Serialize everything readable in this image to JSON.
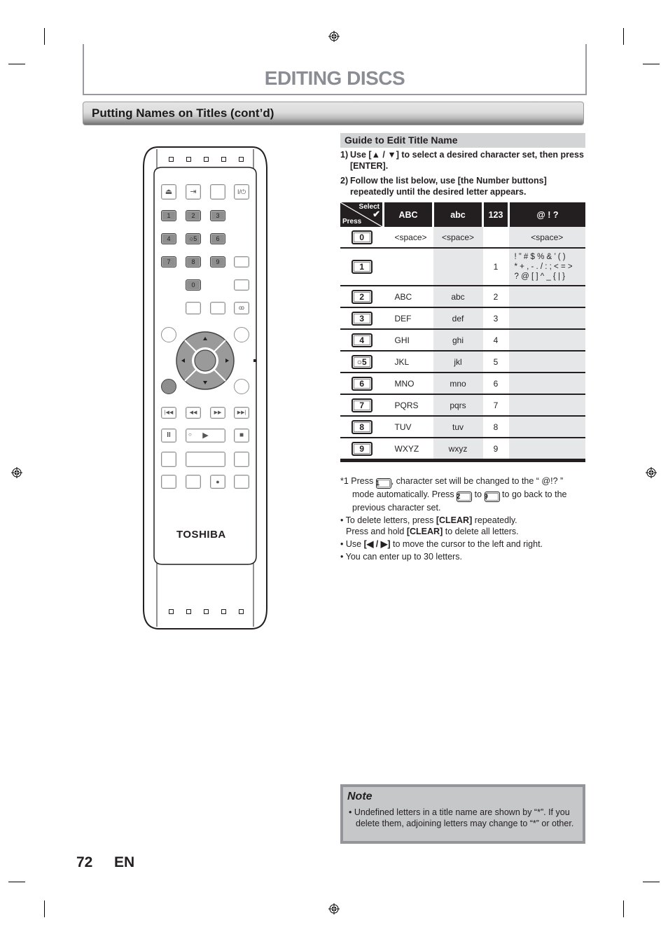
{
  "header": {
    "chapter_title": "EDITING DISCS",
    "section_title": "Putting Names on Titles (cont’d)"
  },
  "guide": {
    "heading": "Guide to Edit Title Name",
    "steps": [
      {
        "num": "1)",
        "text": "Use [▲ / ▼] to select a desired character set, then press [ENTER]."
      },
      {
        "num": "2)",
        "text": "Follow the list below, use [the Number buttons] repeatedly until the desired letter appears."
      }
    ]
  },
  "char_table": {
    "corner_top": "Select",
    "corner_bottom": "Press",
    "columns": [
      "ABC",
      "abc",
      "123",
      "@ ! ?"
    ],
    "rows": [
      {
        "key": "0",
        "abc_upper": "<space>",
        "abc_lower": "<space>",
        "num": "",
        "symbols": "<space>"
      },
      {
        "key": "1",
        "abc_upper": "",
        "abc_lower": "",
        "num": "1",
        "symbols": "! ” # $ % & ’ ( )\n* + , - . / : ; < = >\n? @ [ ] ^ _ { | }"
      },
      {
        "key": "2",
        "abc_upper": "ABC",
        "abc_lower": "abc",
        "num": "2",
        "symbols": ""
      },
      {
        "key": "3",
        "abc_upper": "DEF",
        "abc_lower": "def",
        "num": "3",
        "symbols": ""
      },
      {
        "key": "4",
        "abc_upper": "GHI",
        "abc_lower": "ghi",
        "num": "4",
        "symbols": ""
      },
      {
        "key": "○5",
        "abc_upper": "JKL",
        "abc_lower": "jkl",
        "num": "5",
        "symbols": ""
      },
      {
        "key": "6",
        "abc_upper": "MNO",
        "abc_lower": "mno",
        "num": "6",
        "symbols": ""
      },
      {
        "key": "7",
        "abc_upper": "PQRS",
        "abc_lower": "pqrs",
        "num": "7",
        "symbols": ""
      },
      {
        "key": "8",
        "abc_upper": "TUV",
        "abc_lower": "tuv",
        "num": "8",
        "symbols": ""
      },
      {
        "key": "9",
        "abc_upper": "WXYZ",
        "abc_lower": "wxyz",
        "num": "9",
        "symbols": ""
      }
    ]
  },
  "notes": {
    "footnote_prefix": "*1 Press",
    "footnote_key1": "1",
    "footnote_mid1": ", character set will be changed to the “ @!? ” mode automatically. Press",
    "footnote_key2": "2",
    "footnote_to": "to",
    "footnote_key3": "9",
    "footnote_end": "to go back to the previous character set.",
    "bullet1_a": "• To delete letters, press ",
    "bullet1_b": "[CLEAR]",
    "bullet1_c": " repeatedly.",
    "bullet1_d": "Press and hold ",
    "bullet1_e": "[CLEAR]",
    "bullet1_f": " to delete all letters.",
    "bullet2_a": "• Use ",
    "bullet2_b": "[◀ / ▶]",
    "bullet2_c": " to move the cursor to the left and right.",
    "bullet3": "• You can enter up to 30 letters."
  },
  "note_box": {
    "title": "Note",
    "text": "• Undefined letters in a title name are shown by “*”. If you delete them, adjoining letters may change to “*” or other."
  },
  "footer": {
    "page_number": "72",
    "language": "EN"
  },
  "remote": {
    "brand": "TOSHIBA",
    "number_keys": [
      "1",
      "2",
      "3",
      "4",
      "○5",
      "6",
      "7",
      "8",
      "9",
      "0"
    ],
    "power_label": "I/⏻",
    "icons": {
      "eject": "eject-icon",
      "input": "input-icon",
      "power": "power-icon",
      "audio": "audio-icon",
      "skip_back": "skip-back-icon",
      "rewind": "rewind-icon",
      "fast_forward": "fast-forward-icon",
      "skip_forward": "skip-forward-icon",
      "pause": "pause-icon",
      "play": "play-icon",
      "stop": "stop-icon",
      "record": "record-icon"
    }
  }
}
